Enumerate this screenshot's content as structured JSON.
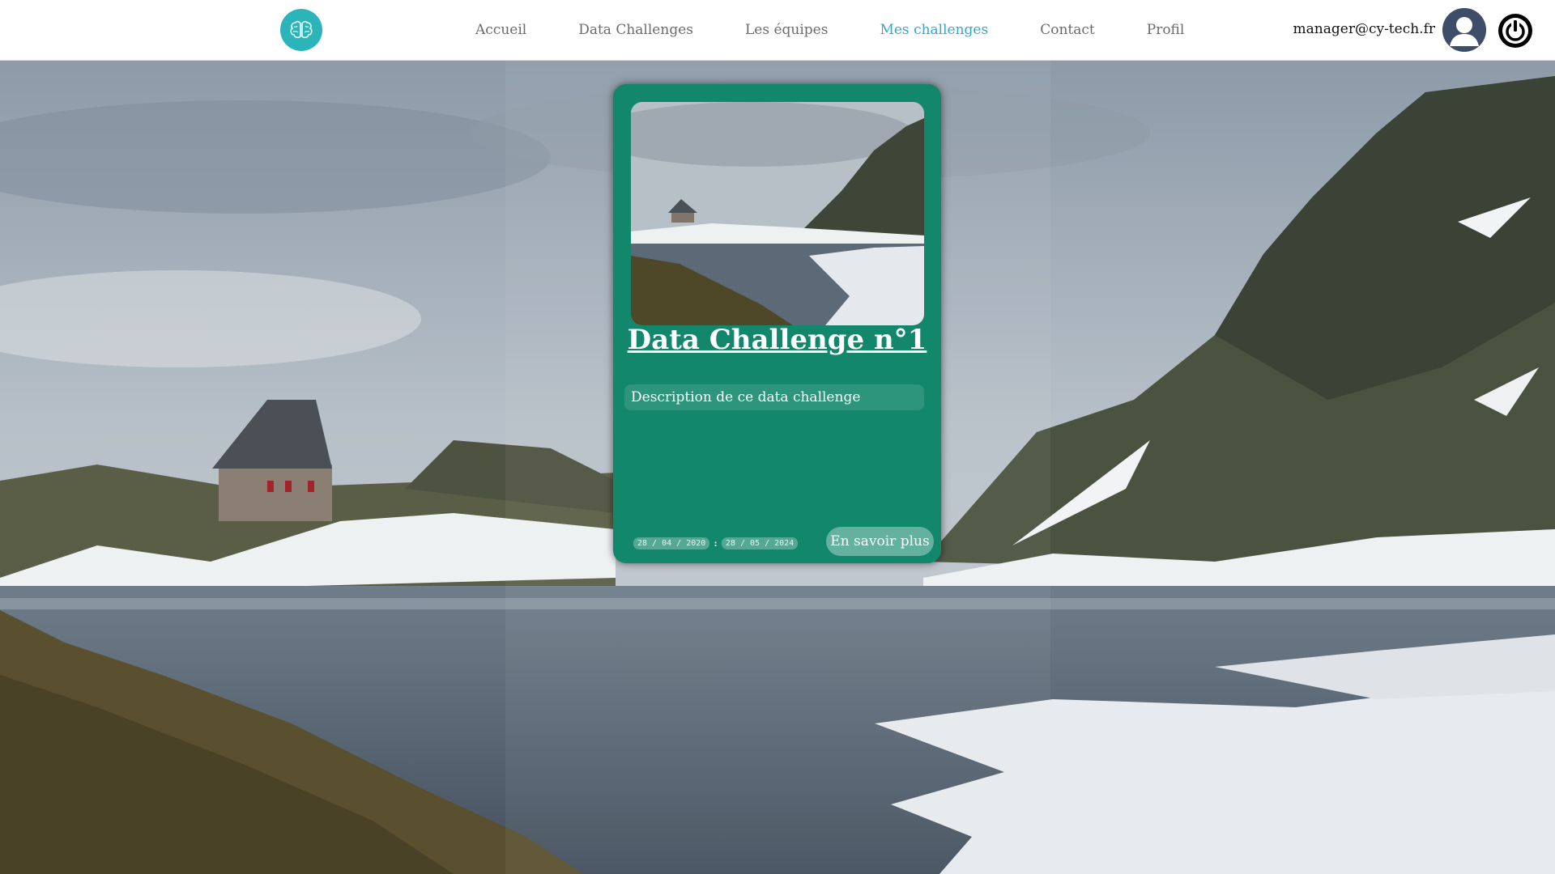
{
  "navbar": {
    "logo_icon": "brain-icon",
    "links": [
      {
        "label": "Accueil"
      },
      {
        "label": "Data Challenges"
      },
      {
        "label": "Les équipes"
      },
      {
        "label": "Mes challenges",
        "active": true
      },
      {
        "label": "Contact"
      },
      {
        "label": "Profil"
      }
    ],
    "user_email": "manager@cy-tech.fr",
    "avatar_icon": "user-avatar-icon",
    "logout_icon": "power-icon"
  },
  "card": {
    "title": "Data Challenge n°1",
    "description": "Description de ce data challenge",
    "start_date": "28 / 04 / 2020",
    "separator": ":",
    "end_date": "28 / 05 / 2024",
    "button_label": "En savoir plus"
  },
  "colors": {
    "card_bg": "#12876c",
    "logo_bg": "#2bb5b8",
    "active_link": "#33a6cf",
    "nav_text": "#6b6b6b"
  }
}
